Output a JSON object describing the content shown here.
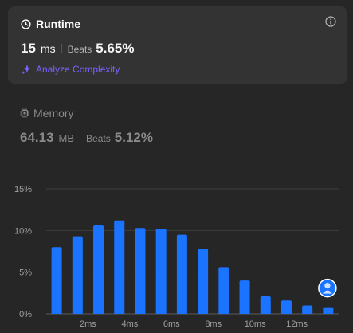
{
  "runtime": {
    "title": "Runtime",
    "value": "15",
    "unit": "ms",
    "beats_label": "Beats",
    "beats_value": "5.65%",
    "analyze_label": "Analyze Complexity"
  },
  "memory": {
    "title": "Memory",
    "value": "64.13",
    "unit": "MB",
    "beats_label": "Beats",
    "beats_value": "5.12%"
  },
  "colors": {
    "bar": "#1a74ff",
    "accent": "#7b61ff",
    "card": "#333333"
  },
  "chart_data": {
    "type": "bar",
    "title": "",
    "xlabel": "",
    "ylabel": "",
    "ylim": [
      0,
      15
    ],
    "y_ticks": [
      "0%",
      "5%",
      "10%",
      "15%"
    ],
    "y_tick_values": [
      0,
      5,
      10,
      15
    ],
    "x_ticks": [
      "2ms",
      "4ms",
      "6ms",
      "8ms",
      "10ms",
      "12ms"
    ],
    "x_tick_values": [
      2,
      4,
      6,
      8,
      10,
      12
    ],
    "x": [
      0.5,
      1.5,
      2.5,
      3.5,
      4.5,
      5.5,
      6.5,
      7.5,
      8.5,
      9.5,
      10.5,
      11.5,
      12.5,
      13.5
    ],
    "values": [
      8.0,
      9.3,
      10.6,
      11.2,
      10.3,
      10.2,
      9.5,
      7.8,
      5.6,
      4.0,
      2.1,
      1.6,
      1.0,
      0.8
    ],
    "highlight_bar_index": 13,
    "grid": true
  }
}
